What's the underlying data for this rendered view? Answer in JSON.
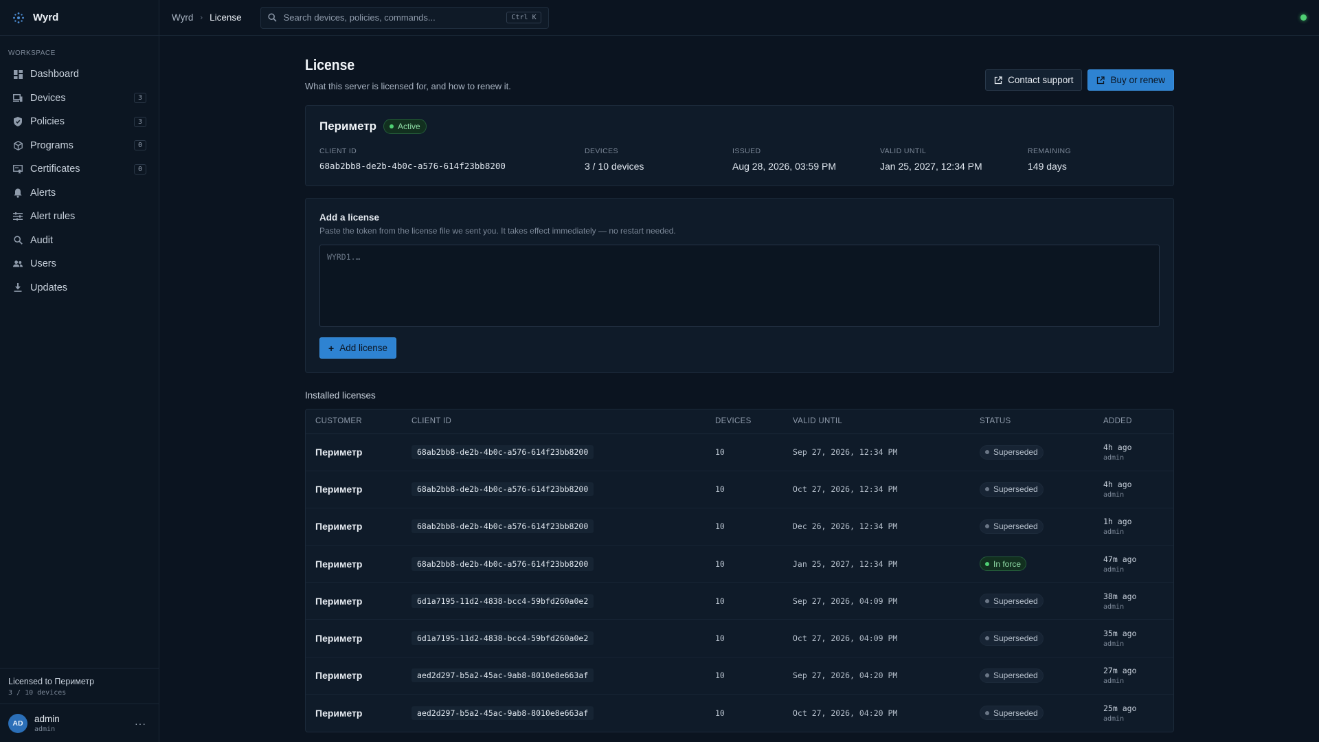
{
  "app": {
    "name": "Wyrd"
  },
  "sidebar": {
    "section_label": "WORKSPACE",
    "items": [
      {
        "label": "Dashboard",
        "icon": "dashboard-icon",
        "badge": null
      },
      {
        "label": "Devices",
        "icon": "devices-icon",
        "badge": "3"
      },
      {
        "label": "Policies",
        "icon": "shield-icon",
        "badge": "3"
      },
      {
        "label": "Programs",
        "icon": "package-icon",
        "badge": "0"
      },
      {
        "label": "Certificates",
        "icon": "certificate-icon",
        "badge": "0"
      },
      {
        "label": "Alerts",
        "icon": "bell-icon",
        "badge": null
      },
      {
        "label": "Alert rules",
        "icon": "sliders-icon",
        "badge": null
      },
      {
        "label": "Audit",
        "icon": "search-icon",
        "badge": null
      },
      {
        "label": "Users",
        "icon": "users-icon",
        "badge": null
      },
      {
        "label": "Updates",
        "icon": "download-icon",
        "badge": null
      }
    ],
    "license_line": "Licensed to Периметр",
    "license_devices": "3 / 10 devices",
    "user": {
      "initials": "AD",
      "name": "admin",
      "role": "admin",
      "menu": "···"
    }
  },
  "topbar": {
    "breadcrumb": [
      "Wyrd",
      "License"
    ],
    "search_placeholder": "Search devices, policies, commands...",
    "shortcut": "Ctrl K",
    "status_color": "#4fcf73"
  },
  "page": {
    "title": "License",
    "subtitle": "What this server is licensed for, and how to renew it.",
    "contact_label": "Contact support",
    "buy_label": "Buy or renew"
  },
  "license": {
    "customer": "Периметр",
    "status": "Active",
    "fields": [
      {
        "label": "CLIENT ID",
        "value": "68ab2bb8-de2b-4b0c-a576-614f23bb8200"
      },
      {
        "label": "DEVICES",
        "value": "3 / 10 devices"
      },
      {
        "label": "ISSUED",
        "value": "Aug 28, 2026, 03:59 PM"
      },
      {
        "label": "VALID UNTIL",
        "value": "Jan 25, 2027, 12:34 PM"
      },
      {
        "label": "REMAINING",
        "value": "149 days"
      }
    ]
  },
  "add_license": {
    "title": "Add a license",
    "subtitle": "Paste the token from the license file we sent you. It takes effect immediately — no restart needed.",
    "placeholder": "WYRD1.…",
    "button": "Add license"
  },
  "installed": {
    "title": "Installed licenses",
    "columns": [
      "CUSTOMER",
      "CLIENT ID",
      "DEVICES",
      "VALID UNTIL",
      "STATUS",
      "ADDED"
    ],
    "rows": [
      {
        "customer": "Периметр",
        "client_id": "68ab2bb8-de2b-4b0c-a576-614f23bb8200",
        "devices": "10",
        "valid_until": "Sep 27, 2026, 12:34 PM",
        "status": "Superseded",
        "added": "4h ago",
        "by": "admin"
      },
      {
        "customer": "Периметр",
        "client_id": "68ab2bb8-de2b-4b0c-a576-614f23bb8200",
        "devices": "10",
        "valid_until": "Oct 27, 2026, 12:34 PM",
        "status": "Superseded",
        "added": "4h ago",
        "by": "admin"
      },
      {
        "customer": "Периметр",
        "client_id": "68ab2bb8-de2b-4b0c-a576-614f23bb8200",
        "devices": "10",
        "valid_until": "Dec 26, 2026, 12:34 PM",
        "status": "Superseded",
        "added": "1h ago",
        "by": "admin"
      },
      {
        "customer": "Периметр",
        "client_id": "68ab2bb8-de2b-4b0c-a576-614f23bb8200",
        "devices": "10",
        "valid_until": "Jan 25, 2027, 12:34 PM",
        "status": "In force",
        "added": "47m ago",
        "by": "admin"
      },
      {
        "customer": "Периметр",
        "client_id": "6d1a7195-11d2-4838-bcc4-59bfd260a0e2",
        "devices": "10",
        "valid_until": "Sep 27, 2026, 04:09 PM",
        "status": "Superseded",
        "added": "38m ago",
        "by": "admin"
      },
      {
        "customer": "Периметр",
        "client_id": "6d1a7195-11d2-4838-bcc4-59bfd260a0e2",
        "devices": "10",
        "valid_until": "Oct 27, 2026, 04:09 PM",
        "status": "Superseded",
        "added": "35m ago",
        "by": "admin"
      },
      {
        "customer": "Периметр",
        "client_id": "aed2d297-b5a2-45ac-9ab8-8010e8e663af",
        "devices": "10",
        "valid_until": "Sep 27, 2026, 04:20 PM",
        "status": "Superseded",
        "added": "27m ago",
        "by": "admin"
      },
      {
        "customer": "Периметр",
        "client_id": "aed2d297-b5a2-45ac-9ab8-8010e8e663af",
        "devices": "10",
        "valid_until": "Oct 27, 2026, 04:20 PM",
        "status": "Superseded",
        "added": "25m ago",
        "by": "admin"
      }
    ]
  }
}
